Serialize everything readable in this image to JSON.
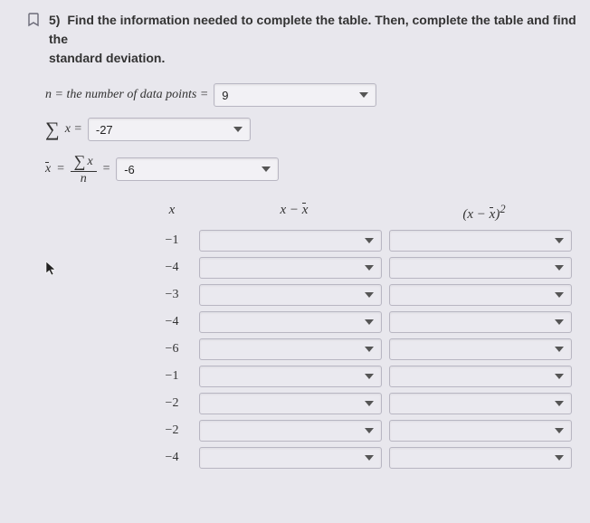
{
  "question": {
    "number": "5)",
    "text": "Find the information needed to complete the table. Then, complete the table and find the",
    "subtext": "standard deviation."
  },
  "n_row": {
    "label": "n = the number of data points =",
    "value": "9"
  },
  "sum_row": {
    "prefix_html": "Σx =",
    "value": "-27"
  },
  "mean_row": {
    "value": "-6"
  },
  "table": {
    "headers": {
      "x": "x",
      "diff": "x − x̄",
      "sq": "(x − x̄)²"
    },
    "rows": [
      {
        "x": "−1"
      },
      {
        "x": "−4"
      },
      {
        "x": "−3"
      },
      {
        "x": "−4"
      },
      {
        "x": "−6"
      },
      {
        "x": "−1"
      },
      {
        "x": "−2"
      },
      {
        "x": "−2"
      },
      {
        "x": "−4"
      }
    ]
  }
}
